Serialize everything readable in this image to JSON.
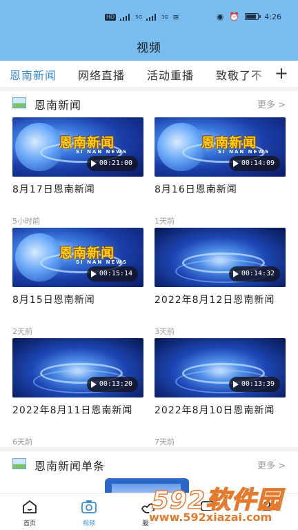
{
  "status": {
    "left_badge": "HD",
    "net1": "5G",
    "net2": "3G",
    "wifi": "6",
    "time": "4:26",
    "battery_level": 0.75
  },
  "header": {
    "title": "视频"
  },
  "tabs": [
    "恩南新闻",
    "网络直播",
    "活动重播",
    "致敬了不"
  ],
  "tabs_add": "+",
  "section1": {
    "title": "恩南新闻",
    "more": "更多 >"
  },
  "videos": [
    {
      "title": "8月17日恩南新闻",
      "duration": "00:21:00",
      "ago": "5小时前",
      "logo": "恩南新闻",
      "logo_sub": "SI NAN NEWS"
    },
    {
      "title": "8月16日恩南新闻",
      "duration": "00:14:09",
      "ago": "1天前",
      "logo": "恩南新闻",
      "logo_sub": "SI NAN NEWS"
    },
    {
      "title": "8月15日恩南新闻",
      "duration": "00:15:14",
      "ago": "2天前",
      "logo": "恩南新闻",
      "logo_sub": "SI NAN NEWS"
    },
    {
      "title": "2022年8月12日恩南新闻",
      "duration": "00:14:32",
      "ago": "3天前"
    },
    {
      "title": "2022年8月11日恩南新闻",
      "duration": "00:13:20",
      "ago": "6天前"
    },
    {
      "title": "2022年8月10日恩南新闻",
      "duration": "00:13:39",
      "ago": "7天前"
    }
  ],
  "section2": {
    "title": "恩南新闻单条",
    "more": "更多 >"
  },
  "bottom_nav": [
    {
      "label": "首页",
      "icon": "home-icon"
    },
    {
      "label": "视频",
      "icon": "camera-icon"
    },
    {
      "label": "服务",
      "icon": "hand-icon"
    },
    {
      "label": "",
      "icon": "chat-icon"
    },
    {
      "label": "",
      "icon": "user-icon"
    }
  ],
  "watermark": {
    "brand": "592软件园",
    "url": "www.592xiazai.com"
  },
  "colors": {
    "header": "#79bdf0",
    "accent": "#3a8ed6"
  }
}
